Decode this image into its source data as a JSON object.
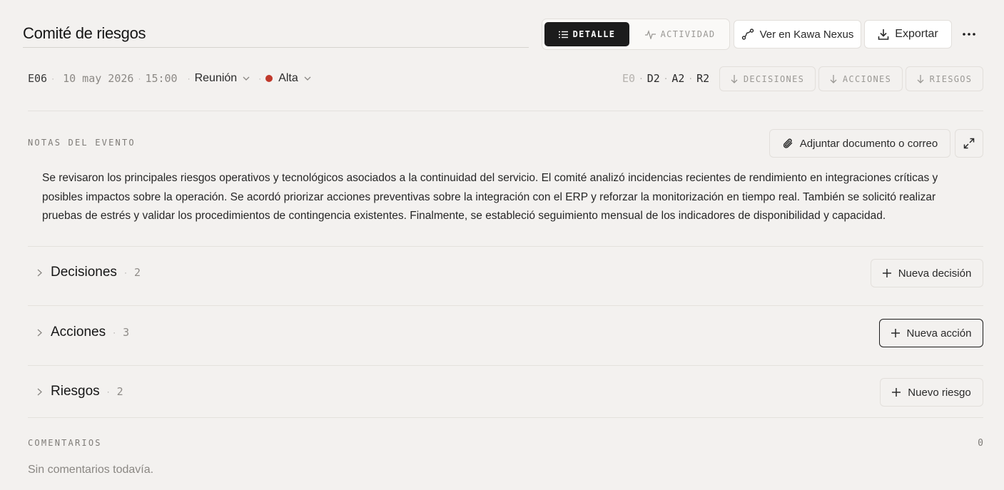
{
  "header": {
    "title": "Comité de riesgos",
    "tabs": [
      {
        "label": "DETALLE",
        "active": true
      },
      {
        "label": "ACTIVIDAD",
        "active": false
      }
    ],
    "nexus_label": "Ver en Kawa Nexus",
    "export_label": "Exportar",
    "more_icon": "more-horizontal-icon"
  },
  "meta": {
    "code": "E06",
    "date": "10 may 2026",
    "time": "15:00",
    "type": "Reunión",
    "priority": "Alta",
    "priority_color": "#c0392b",
    "counts": {
      "e": "E0",
      "d": "D2",
      "a": "A2",
      "r": "R2"
    },
    "jump_links": [
      "DECISIONES",
      "ACCIONES",
      "RIESGOS"
    ]
  },
  "notes": {
    "label": "NOTAS DEL EVENTO",
    "attach_label": "Adjuntar documento o correo",
    "text": "Se revisaron los principales riesgos operativos y tecnológicos asociados a la continuidad del servicio. El comité analizó incidencias recientes de rendimiento en integraciones críticas y posibles impactos sobre la operación. Se acordó priorizar acciones preventivas sobre la integración con el ERP y reforzar la monitorización en tiempo real. También se solicitó realizar pruebas de estrés y validar los procedimientos de contingencia existentes. Finalmente, se estableció seguimiento mensual de los indicadores de disponibilidad y capacidad."
  },
  "sections": [
    {
      "name": "Decisiones",
      "count": "2",
      "add_label": "Nueva decisión"
    },
    {
      "name": "Acciones",
      "count": "3",
      "add_label": "Nueva acción"
    },
    {
      "name": "Riesgos",
      "count": "2",
      "add_label": "Nuevo riesgo"
    }
  ],
  "comments": {
    "label": "COMENTARIOS",
    "count": "0",
    "empty_text": "Sin comentarios todavía."
  }
}
